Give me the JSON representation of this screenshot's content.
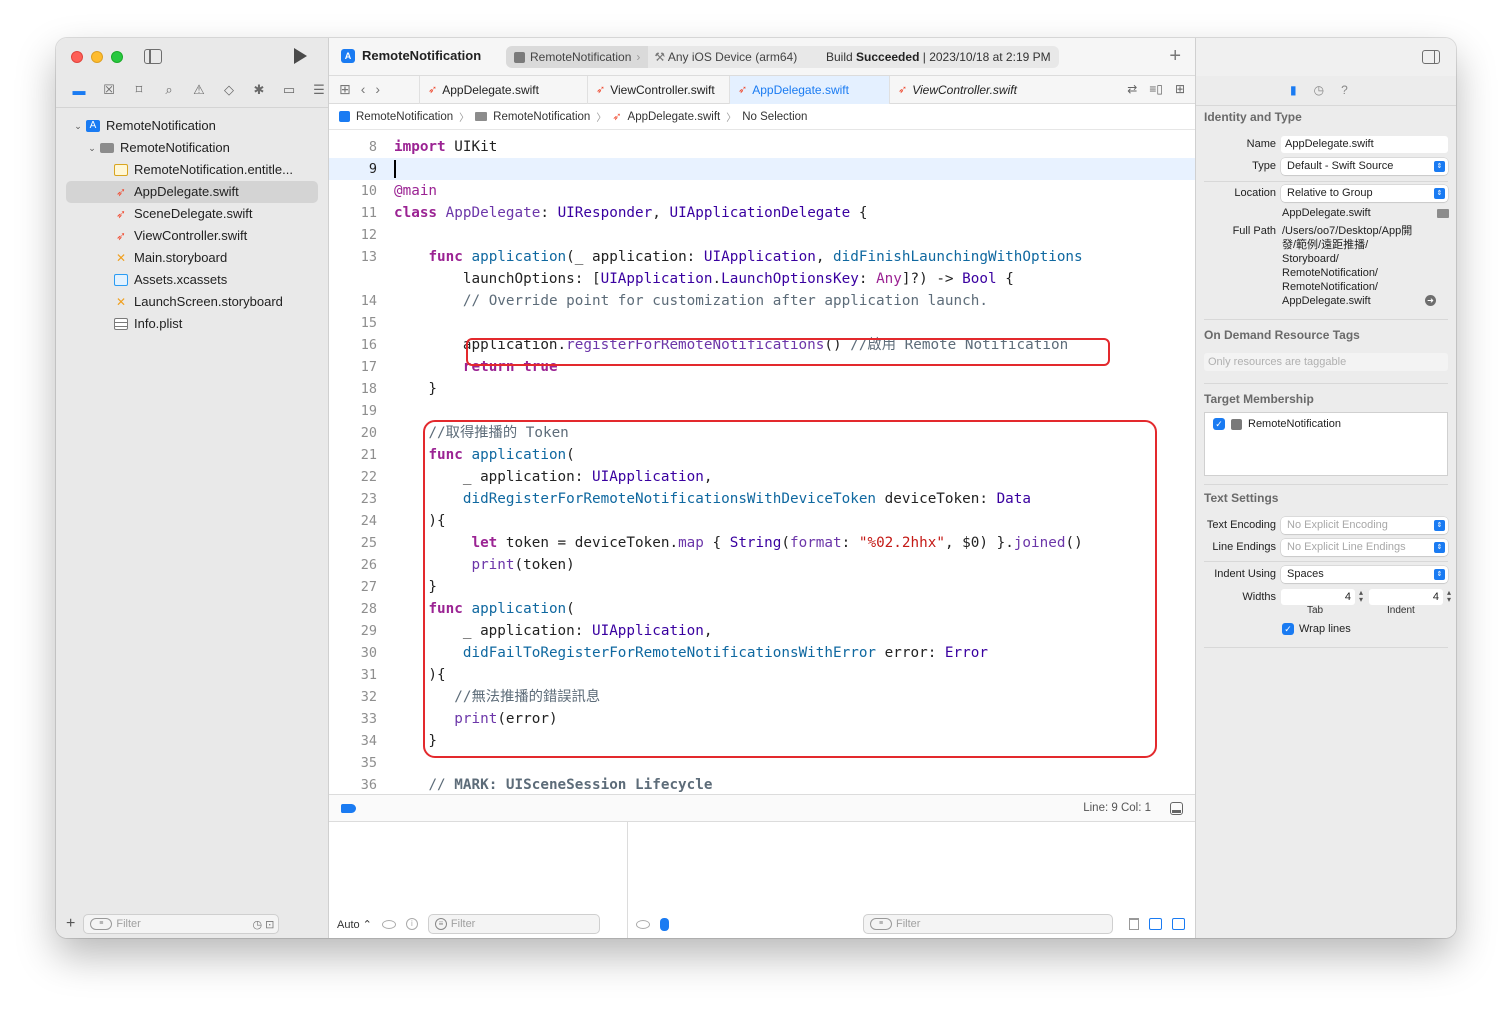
{
  "navigator": {
    "tree": [
      {
        "label": "RemoteNotification",
        "icon": "project-icon",
        "level": 0
      },
      {
        "label": "RemoteNotification",
        "icon": "folder-icon",
        "level": 1
      },
      {
        "label": "RemoteNotification.entitle...",
        "icon": "entitlements-icon",
        "level": 2
      },
      {
        "label": "AppDelegate.swift",
        "icon": "swift-file-icon",
        "level": 2,
        "selected": true
      },
      {
        "label": "SceneDelegate.swift",
        "icon": "swift-file-icon",
        "level": 2
      },
      {
        "label": "ViewController.swift",
        "icon": "swift-file-icon",
        "level": 2
      },
      {
        "label": "Main.storyboard",
        "icon": "storyboard-icon",
        "level": 2
      },
      {
        "label": "Assets.xcassets",
        "icon": "assets-icon",
        "level": 2
      },
      {
        "label": "LaunchScreen.storyboard",
        "icon": "storyboard-icon",
        "level": 2
      },
      {
        "label": "Info.plist",
        "icon": "plist-icon",
        "level": 2
      }
    ],
    "filter_placeholder": "Filter"
  },
  "toolbar": {
    "project_title": "RemoteNotification",
    "scheme": "RemoteNotification",
    "destination": "Any iOS Device (arm64)",
    "build_prefix": "Build",
    "build_status": "Succeeded",
    "build_time": "| 2023/10/18 at 2:19 PM"
  },
  "tabs": [
    {
      "label": "AppDelegate.swift",
      "active": false,
      "italic": false
    },
    {
      "label": "ViewController.swift",
      "active": false,
      "italic": false
    },
    {
      "label": "AppDelegate.swift",
      "active": true,
      "italic": false
    },
    {
      "label": "ViewController.swift",
      "active": false,
      "italic": true
    }
  ],
  "jumpbar": {
    "project": "RemoteNotification",
    "group": "RemoteNotification",
    "file": "AppDelegate.swift",
    "selection": "No Selection"
  },
  "editor": {
    "current_line": 9,
    "lines": [
      {
        "n": "8",
        "html": "<span class='kw'>import</span> UIKit"
      },
      {
        "n": "9",
        "html": ""
      },
      {
        "n": "10",
        "html": "<span class='kw' style='font-weight:normal'>@main</span>"
      },
      {
        "n": "11",
        "html": "<span class='kw'>class</span> <span class='pj'>AppDelegate</span>: <span class='ty'>UIResponder</span>, <span class='ty'>UIApplicationDelegate</span> {"
      },
      {
        "n": "12",
        "html": ""
      },
      {
        "n": "13",
        "html": "    <span class='kw'>func</span> <span class='fn'>application</span>(_ application: <span class='ty'>UIApplication</span>, <span class='fn'>didFinishLaunchingWithOptions</span>"
      },
      {
        "n": "",
        "html": "        launchOptions: [<span class='ty'>UIApplication</span>.<span class='ty'>LaunchOptionsKey</span>: <span class='kw' style='font-weight:normal'>Any</span>]?) -> <span class='ty'>Bool</span> {"
      },
      {
        "n": "14",
        "html": "        <span class='cm'>// Override point for customization after application launch.</span>"
      },
      {
        "n": "15",
        "html": ""
      },
      {
        "n": "16",
        "html": "        application.<span class='pr'>registerForRemoteNotifications</span>() <span class='cm'>//啟用 Remote Notification</span>"
      },
      {
        "n": "17",
        "html": "        <span class='kw'>return</span> <span class='kw'>true</span>"
      },
      {
        "n": "18",
        "html": "    }"
      },
      {
        "n": "19",
        "html": ""
      },
      {
        "n": "20",
        "html": "    <span class='cm'>//取得推播的 Token</span>"
      },
      {
        "n": "21",
        "html": "    <span class='kw'>func</span> <span class='fn'>application</span>("
      },
      {
        "n": "22",
        "html": "        _ application: <span class='ty'>UIApplication</span>,"
      },
      {
        "n": "23",
        "html": "        <span class='fn'>didRegisterForRemoteNotificationsWithDeviceToken</span> deviceToken: <span class='ty'>Data</span>"
      },
      {
        "n": "24",
        "html": "    ){"
      },
      {
        "n": "25",
        "html": "         <span class='kw'>let</span> token = deviceToken.<span class='pr'>map</span> { <span class='ty'>String</span>(<span class='pr'>format</span>: <span class='str'>\"%02.2hhx\"</span>, $0) }.<span class='pr'>joined</span>()"
      },
      {
        "n": "26",
        "html": "         <span class='pr'>print</span>(token)"
      },
      {
        "n": "27",
        "html": "    }"
      },
      {
        "n": "28",
        "html": "    <span class='kw'>func</span> <span class='fn'>application</span>("
      },
      {
        "n": "29",
        "html": "        _ application: <span class='ty'>UIApplication</span>,"
      },
      {
        "n": "30",
        "html": "        <span class='fn'>didFailToRegisterForRemoteNotificationsWithError</span> error: <span class='ty'>Error</span>"
      },
      {
        "n": "31",
        "html": "    ){"
      },
      {
        "n": "32",
        "html": "       <span class='cm'>//無法推播的錯誤訊息</span>"
      },
      {
        "n": "33",
        "html": "       <span class='pr'>print</span>(error)"
      },
      {
        "n": "34",
        "html": "    }"
      },
      {
        "n": "35",
        "html": ""
      },
      {
        "n": "36",
        "html": "    <span class='cm'>// <b>MARK: UISceneSession Lifecycle</b></span>"
      }
    ]
  },
  "status": {
    "line_col": "Line: 9  Col: 1"
  },
  "console": {
    "auto_label": "Auto ⌃",
    "filter_left": "Filter",
    "filter_right": "Filter"
  },
  "inspector": {
    "identity_title": "Identity and Type",
    "name_label": "Name",
    "name_value": "AppDelegate.swift",
    "type_label": "Type",
    "type_value": "Default - Swift Source",
    "location_label": "Location",
    "location_value": "Relative to Group",
    "location_file": "AppDelegate.swift",
    "fullpath_label": "Full Path",
    "fullpath_lines": [
      "/Users/oo7/Desktop/App開",
      "發/範例/遠距推播/",
      "Storyboard/",
      "RemoteNotification/",
      "RemoteNotification/",
      "AppDelegate.swift"
    ],
    "odr_title": "On Demand Resource Tags",
    "odr_placeholder": "Only resources are taggable",
    "target_title": "Target Membership",
    "target_item": "RemoteNotification",
    "text_title": "Text Settings",
    "encoding_label": "Text Encoding",
    "encoding_value": "No Explicit Encoding",
    "endings_label": "Line Endings",
    "endings_value": "No Explicit Line Endings",
    "indent_label": "Indent Using",
    "indent_value": "Spaces",
    "widths_label": "Widths",
    "tab_width": "4",
    "indent_width": "4",
    "tab_caption": "Tab",
    "indent_caption": "Indent",
    "wrap_label": "Wrap lines"
  }
}
